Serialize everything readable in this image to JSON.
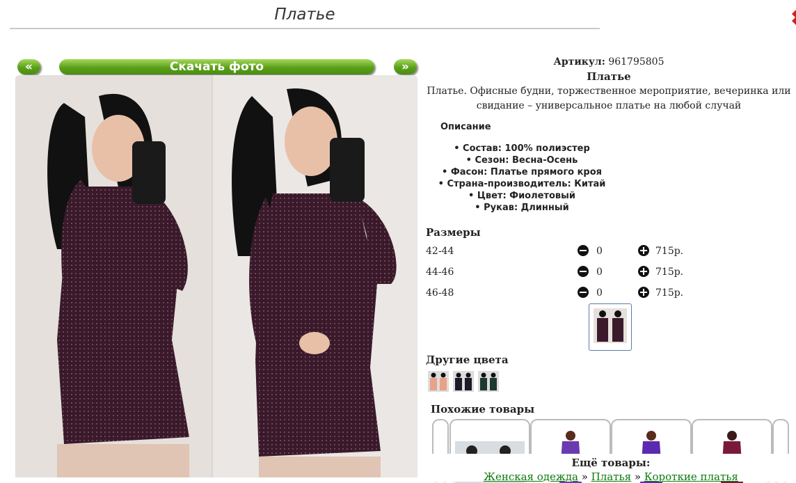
{
  "header": {
    "title": "Платье"
  },
  "gallery": {
    "prev_label": "«",
    "download_label": "Скачать фото",
    "next_label": "»"
  },
  "product": {
    "article_label": "Артикул:",
    "article_value": "961795805",
    "name": "Платье",
    "description": "Платье. Офисные будни, торжественное мероприятие, вечеринка или свидание – универсальное платье на любой случай",
    "description_heading": "Описание",
    "specs": [
      "Состав: 100% полиэстер",
      "Сезон: Весна-Осень",
      "Фасон: Платье прямого кроя",
      "Страна-производитель: Китай",
      "Цвет: Фиолетовый",
      "Рукав: Длинный"
    ]
  },
  "sizes": {
    "heading": "Размеры",
    "rows": [
      {
        "label": "42-44",
        "qty": "0",
        "price": "715р."
      },
      {
        "label": "44-46",
        "qty": "0",
        "price": "715р."
      },
      {
        "label": "46-48",
        "qty": "0",
        "price": "715р."
      }
    ]
  },
  "other_colors": {
    "heading": "Другие цвета"
  },
  "similar": {
    "heading": "Похожие товары"
  },
  "more": {
    "heading": "Ещё товары:",
    "crumbs": [
      "Женская одежда",
      "Платья",
      "Короткие платья"
    ],
    "separator": "»"
  },
  "colors": {
    "accent": "#5aa01a",
    "link": "#0b7a0b",
    "dress": "#3a1a2a"
  }
}
